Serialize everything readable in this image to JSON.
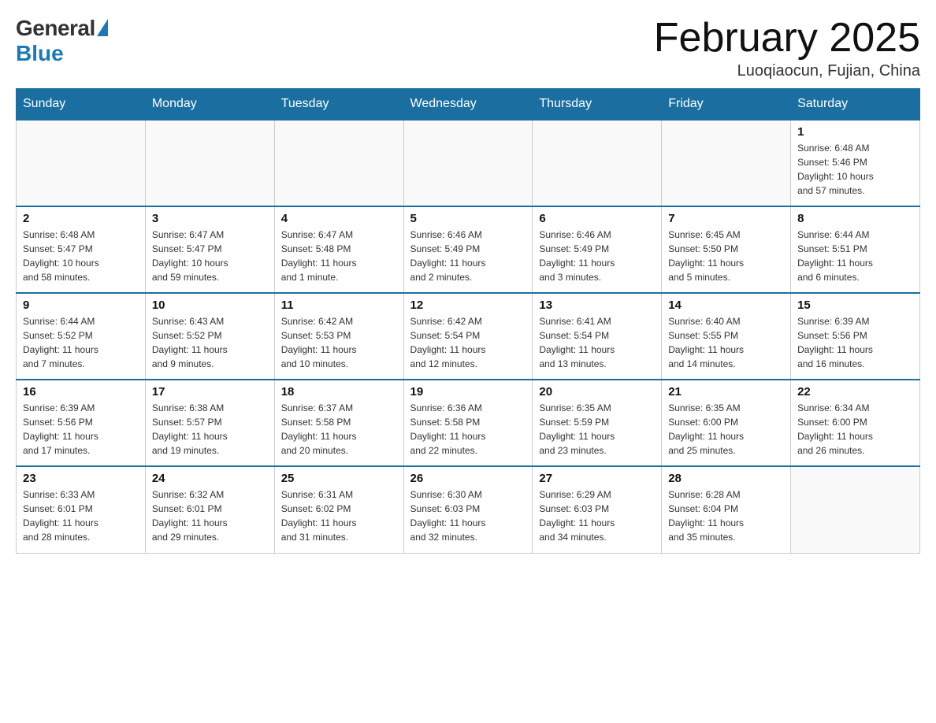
{
  "logo": {
    "general": "General",
    "blue": "Blue"
  },
  "title": "February 2025",
  "location": "Luoqiaocun, Fujian, China",
  "weekdays": [
    "Sunday",
    "Monday",
    "Tuesday",
    "Wednesday",
    "Thursday",
    "Friday",
    "Saturday"
  ],
  "weeks": [
    [
      {
        "day": "",
        "info": ""
      },
      {
        "day": "",
        "info": ""
      },
      {
        "day": "",
        "info": ""
      },
      {
        "day": "",
        "info": ""
      },
      {
        "day": "",
        "info": ""
      },
      {
        "day": "",
        "info": ""
      },
      {
        "day": "1",
        "info": "Sunrise: 6:48 AM\nSunset: 5:46 PM\nDaylight: 10 hours\nand 57 minutes."
      }
    ],
    [
      {
        "day": "2",
        "info": "Sunrise: 6:48 AM\nSunset: 5:47 PM\nDaylight: 10 hours\nand 58 minutes."
      },
      {
        "day": "3",
        "info": "Sunrise: 6:47 AM\nSunset: 5:47 PM\nDaylight: 10 hours\nand 59 minutes."
      },
      {
        "day": "4",
        "info": "Sunrise: 6:47 AM\nSunset: 5:48 PM\nDaylight: 11 hours\nand 1 minute."
      },
      {
        "day": "5",
        "info": "Sunrise: 6:46 AM\nSunset: 5:49 PM\nDaylight: 11 hours\nand 2 minutes."
      },
      {
        "day": "6",
        "info": "Sunrise: 6:46 AM\nSunset: 5:49 PM\nDaylight: 11 hours\nand 3 minutes."
      },
      {
        "day": "7",
        "info": "Sunrise: 6:45 AM\nSunset: 5:50 PM\nDaylight: 11 hours\nand 5 minutes."
      },
      {
        "day": "8",
        "info": "Sunrise: 6:44 AM\nSunset: 5:51 PM\nDaylight: 11 hours\nand 6 minutes."
      }
    ],
    [
      {
        "day": "9",
        "info": "Sunrise: 6:44 AM\nSunset: 5:52 PM\nDaylight: 11 hours\nand 7 minutes."
      },
      {
        "day": "10",
        "info": "Sunrise: 6:43 AM\nSunset: 5:52 PM\nDaylight: 11 hours\nand 9 minutes."
      },
      {
        "day": "11",
        "info": "Sunrise: 6:42 AM\nSunset: 5:53 PM\nDaylight: 11 hours\nand 10 minutes."
      },
      {
        "day": "12",
        "info": "Sunrise: 6:42 AM\nSunset: 5:54 PM\nDaylight: 11 hours\nand 12 minutes."
      },
      {
        "day": "13",
        "info": "Sunrise: 6:41 AM\nSunset: 5:54 PM\nDaylight: 11 hours\nand 13 minutes."
      },
      {
        "day": "14",
        "info": "Sunrise: 6:40 AM\nSunset: 5:55 PM\nDaylight: 11 hours\nand 14 minutes."
      },
      {
        "day": "15",
        "info": "Sunrise: 6:39 AM\nSunset: 5:56 PM\nDaylight: 11 hours\nand 16 minutes."
      }
    ],
    [
      {
        "day": "16",
        "info": "Sunrise: 6:39 AM\nSunset: 5:56 PM\nDaylight: 11 hours\nand 17 minutes."
      },
      {
        "day": "17",
        "info": "Sunrise: 6:38 AM\nSunset: 5:57 PM\nDaylight: 11 hours\nand 19 minutes."
      },
      {
        "day": "18",
        "info": "Sunrise: 6:37 AM\nSunset: 5:58 PM\nDaylight: 11 hours\nand 20 minutes."
      },
      {
        "day": "19",
        "info": "Sunrise: 6:36 AM\nSunset: 5:58 PM\nDaylight: 11 hours\nand 22 minutes."
      },
      {
        "day": "20",
        "info": "Sunrise: 6:35 AM\nSunset: 5:59 PM\nDaylight: 11 hours\nand 23 minutes."
      },
      {
        "day": "21",
        "info": "Sunrise: 6:35 AM\nSunset: 6:00 PM\nDaylight: 11 hours\nand 25 minutes."
      },
      {
        "day": "22",
        "info": "Sunrise: 6:34 AM\nSunset: 6:00 PM\nDaylight: 11 hours\nand 26 minutes."
      }
    ],
    [
      {
        "day": "23",
        "info": "Sunrise: 6:33 AM\nSunset: 6:01 PM\nDaylight: 11 hours\nand 28 minutes."
      },
      {
        "day": "24",
        "info": "Sunrise: 6:32 AM\nSunset: 6:01 PM\nDaylight: 11 hours\nand 29 minutes."
      },
      {
        "day": "25",
        "info": "Sunrise: 6:31 AM\nSunset: 6:02 PM\nDaylight: 11 hours\nand 31 minutes."
      },
      {
        "day": "26",
        "info": "Sunrise: 6:30 AM\nSunset: 6:03 PM\nDaylight: 11 hours\nand 32 minutes."
      },
      {
        "day": "27",
        "info": "Sunrise: 6:29 AM\nSunset: 6:03 PM\nDaylight: 11 hours\nand 34 minutes."
      },
      {
        "day": "28",
        "info": "Sunrise: 6:28 AM\nSunset: 6:04 PM\nDaylight: 11 hours\nand 35 minutes."
      },
      {
        "day": "",
        "info": ""
      }
    ]
  ]
}
